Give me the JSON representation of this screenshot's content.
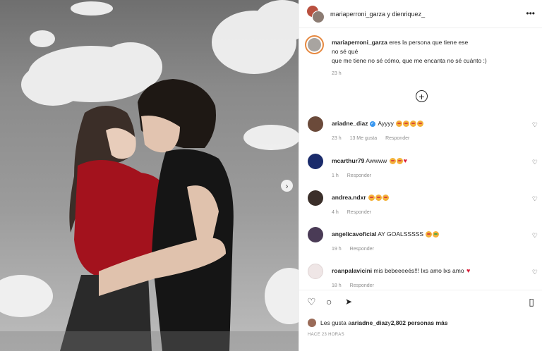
{
  "header": {
    "users": "mariaperroni_garza y dienriquez_",
    "more_icon": "•••"
  },
  "caption": {
    "username": "mariaperroni_garza",
    "line1": " eres la persona que tiene ese",
    "line2": "no sé qué",
    "line3": "que me tiene no sé cómo, que me encanta no sé cuánto :)",
    "time": "23 h"
  },
  "load_more_icon": "+",
  "next_arrow": "›",
  "comments": [
    {
      "username": "ariadne_diaz",
      "verified": "✓",
      "text": " Ayyyy ",
      "time": "23 h",
      "likes": "13 Me gusta",
      "reply": "Responder",
      "avatar_color": "#6b4a3a"
    },
    {
      "username": "mcarthur79",
      "text": " Awwww ",
      "time": "1 h",
      "reply": "Responder",
      "avatar_color": "#1a2b6b"
    },
    {
      "username": "andrea.ndxr",
      "text": " ",
      "time": "4 h",
      "reply": "Responder",
      "avatar_color": "#3b2f2a"
    },
    {
      "username": "angelicavoficial",
      "text": " AY GOALSSSSS ",
      "time": "19 h",
      "reply": "Responder",
      "avatar_color": "#4a3b56"
    },
    {
      "username": "roanpalavicini",
      "text": " mis bebeeeeés!!! lxs amo lxs amo ",
      "time": "18 h",
      "reply": "Responder",
      "avatar_color": "#e9e2e2"
    }
  ],
  "heart_icon": "♡",
  "actions": {
    "like_icon": "♡",
    "comment_icon": "○",
    "share_icon": "➤",
    "save_icon": "▯"
  },
  "likes": {
    "prefix": "Les gusta a ",
    "user": "ariadne_diaz",
    "middle": " y ",
    "count": "2,802 personas más"
  },
  "post_date": "HACE 23 HORAS"
}
